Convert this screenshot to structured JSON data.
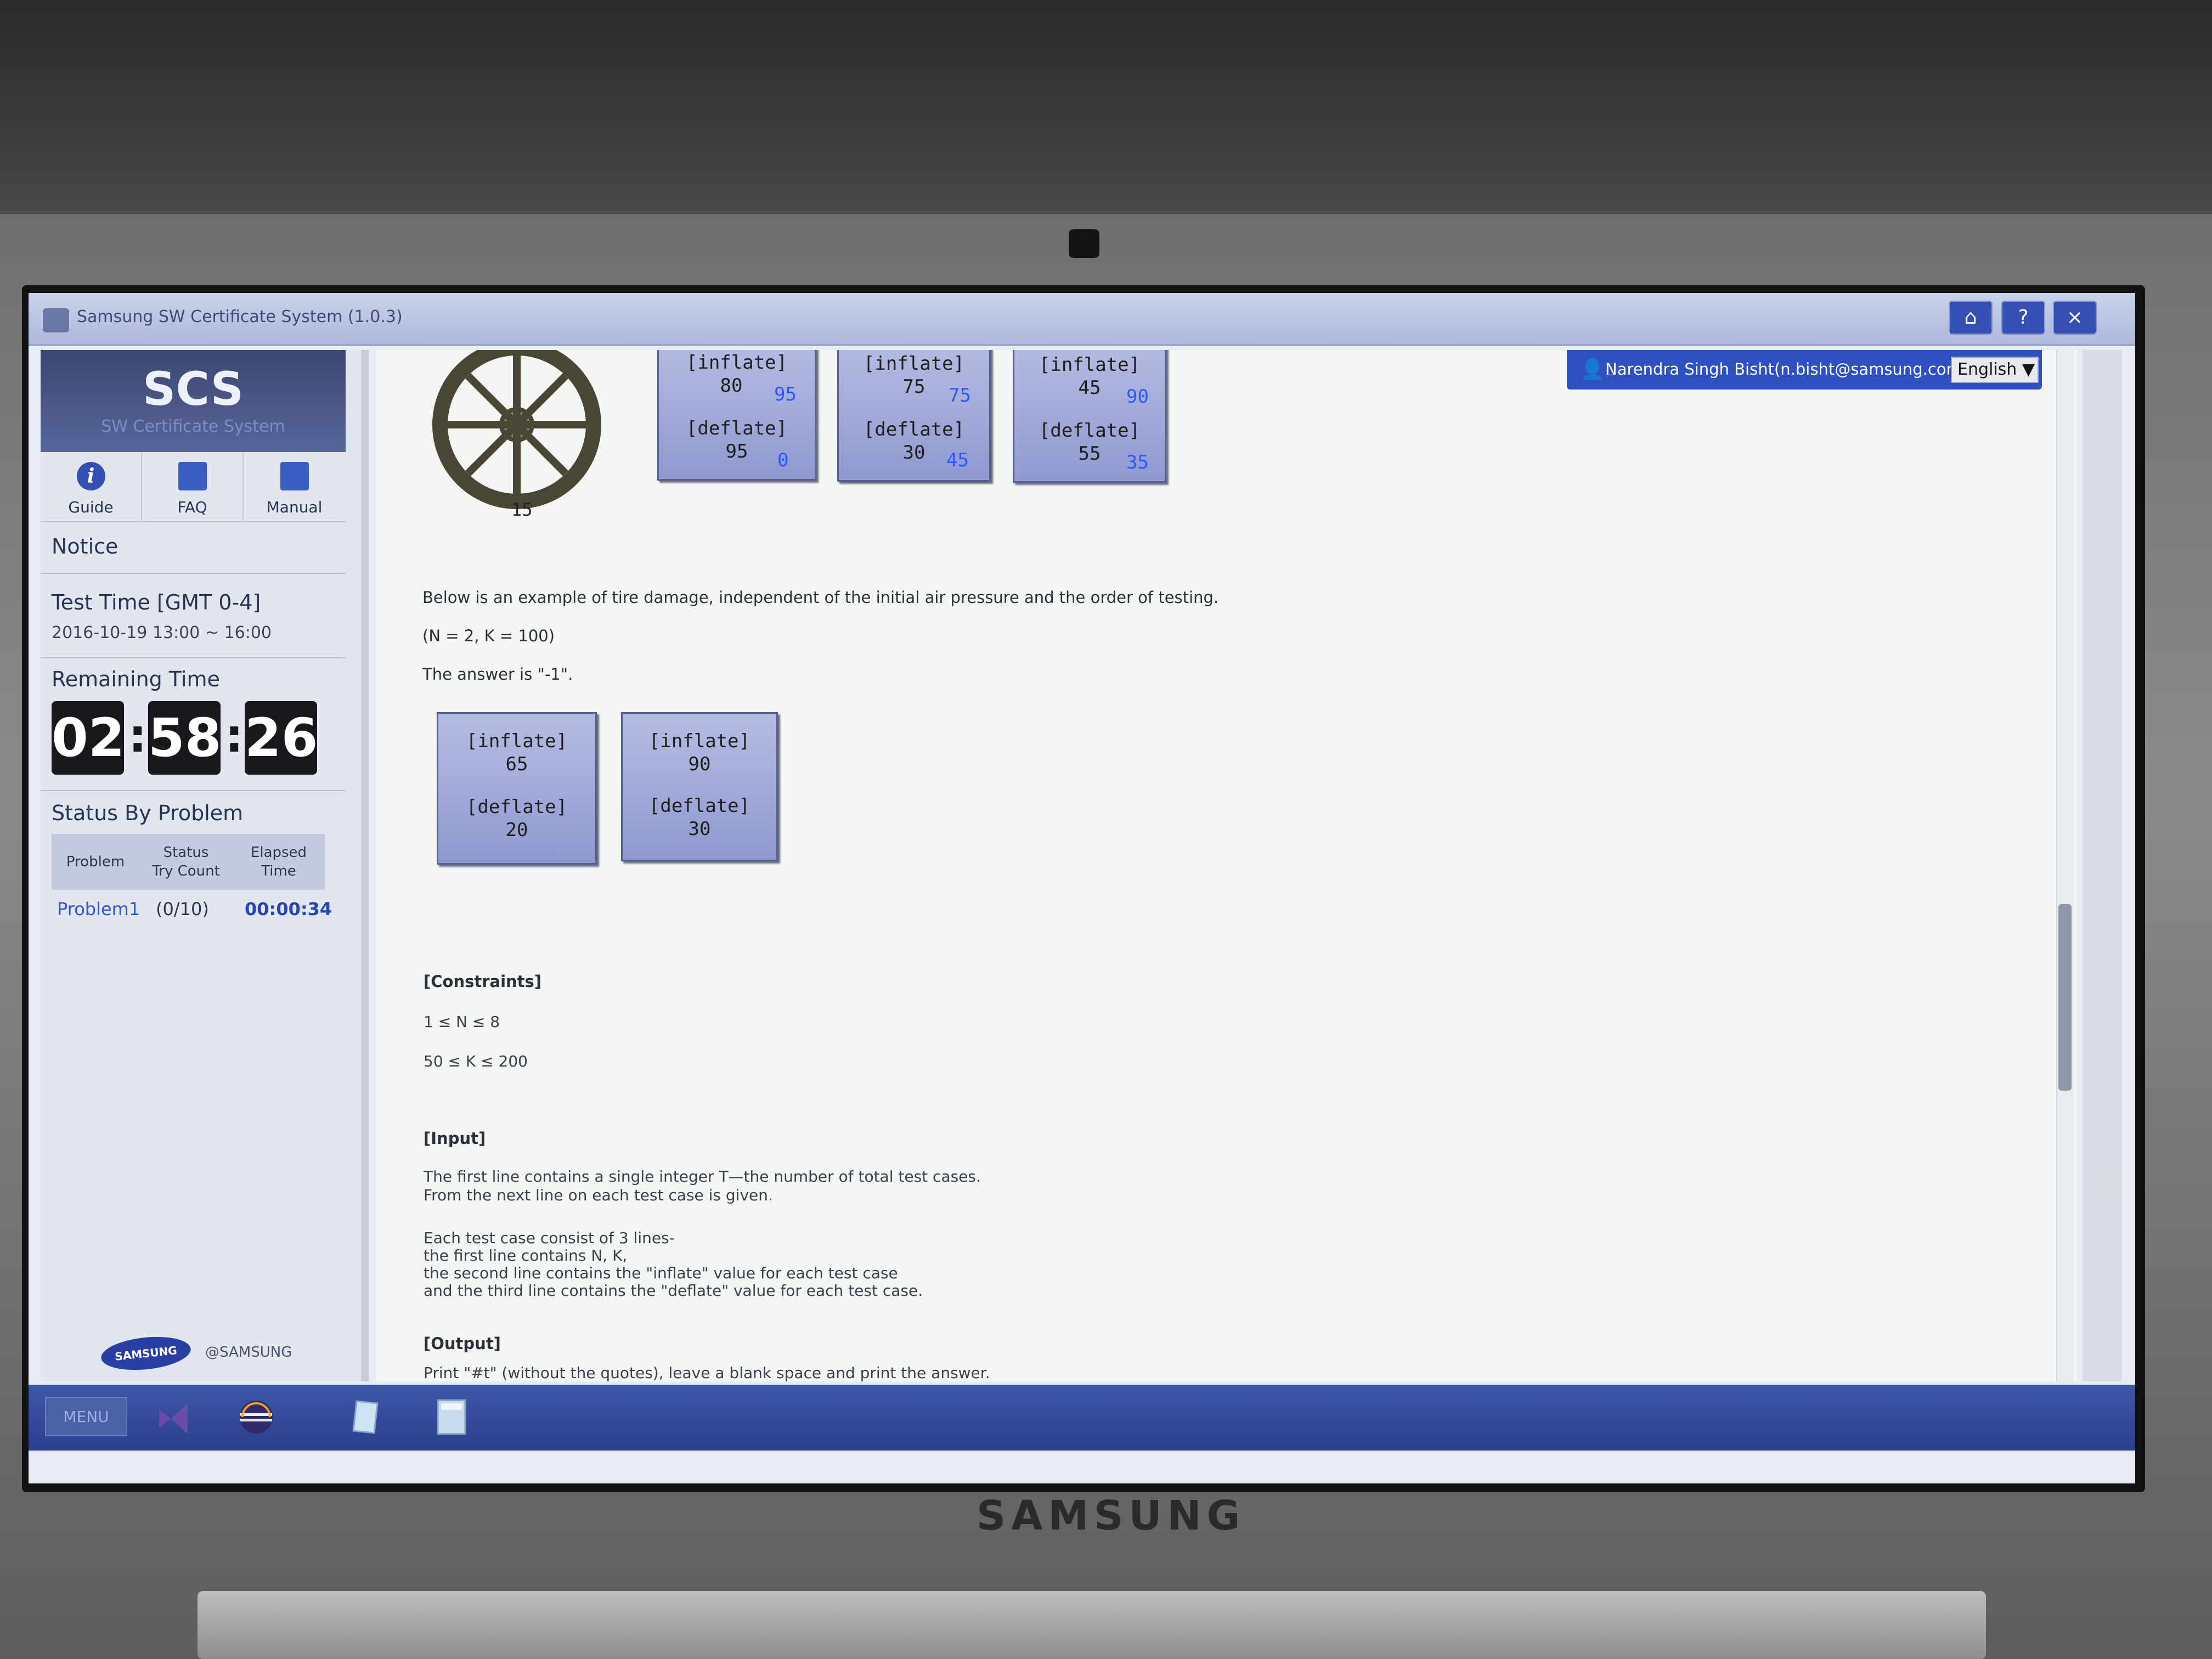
{
  "device": {
    "brand": "SAMSUNG"
  },
  "window": {
    "title": "Samsung SW Certificate System (1.0.3)",
    "buttons": {
      "home": "⌂",
      "help": "?",
      "close": "×"
    }
  },
  "sidebar": {
    "logo_title": "SCS",
    "logo_subtitle": "SW Certificate System",
    "quick_links": [
      {
        "label": "Guide",
        "icon": "info-icon"
      },
      {
        "label": "FAQ",
        "icon": "faq-book-icon"
      },
      {
        "label": "Manual",
        "icon": "manual-book-icon"
      }
    ],
    "notice": "Notice",
    "test_time_label": "Test Time [GMT 0-4]",
    "test_time_value": "2016-10-19 13:00 ~ 16:00",
    "remaining_label": "Remaining Time",
    "remaining": {
      "hours": "02",
      "minutes": "58",
      "seconds": "26"
    },
    "status_label": "Status By Problem",
    "status_headers": [
      "Problem",
      "Status\nTry Count",
      "Elapsed\nTime"
    ],
    "status_rows": [
      {
        "problem": "Problem1",
        "count": "(0/10)",
        "elapsed": "00:00:34"
      }
    ],
    "footer_logo": "SAMSUNG",
    "footer_copy": "@SAMSUNG"
  },
  "header": {
    "user": "Narendra Singh Bisht(n.bisht@samsung.com)",
    "language": "English ▼"
  },
  "problem": {
    "top_example": {
      "wheel_label": "15",
      "boxes": [
        {
          "inflate_label": "[inflate]",
          "inflate": "80",
          "deflate_label": "[deflate]",
          "deflate": "95",
          "blue_top": "95",
          "blue_bottom": "0"
        },
        {
          "inflate_label": "[inflate]",
          "inflate": "75",
          "deflate_label": "[deflate]",
          "deflate": "30",
          "blue_top": "75",
          "blue_bottom": "45"
        },
        {
          "inflate_label": "[inflate]",
          "inflate": "45",
          "deflate_label": "[deflate]",
          "deflate": "55",
          "blue_top": "90",
          "blue_bottom": "35"
        }
      ]
    },
    "example_intro": "Below is an example of tire damage, independent of the initial air pressure and the order of testing.",
    "example_params": "(N = 2, K = 100)",
    "example_answer": "The answer is \"-1\".",
    "example_boxes": [
      {
        "inflate_label": "[inflate]",
        "inflate": "65",
        "deflate_label": "[deflate]",
        "deflate": "20"
      },
      {
        "inflate_label": "[inflate]",
        "inflate": "90",
        "deflate_label": "[deflate]",
        "deflate": "30"
      }
    ],
    "constraints_title": "[Constraints]",
    "constraints": [
      "1 ≤ N ≤ 8",
      "50 ≤ K ≤ 200"
    ],
    "input_title": "[Input]",
    "input_lines": [
      "The first line contains a single integer T—the number of total test cases.",
      "From the next line on each test case is given.",
      "",
      "Each test case consist of 3 lines-",
      "the first line contains N, K,",
      "the second line contains the \"inflate\" value for each test case",
      "and the third line contains the \"deflate\" value for each test case."
    ],
    "output_title": "[Output]",
    "output_line": "Print \"#t\" (without the quotes), leave a blank space and print the answer."
  },
  "taskbar": {
    "menu": "MENU"
  },
  "colors": {
    "accent": "#3450b4",
    "blue_values": "#2f56ff",
    "sidebar_header": "#3b4872"
  }
}
